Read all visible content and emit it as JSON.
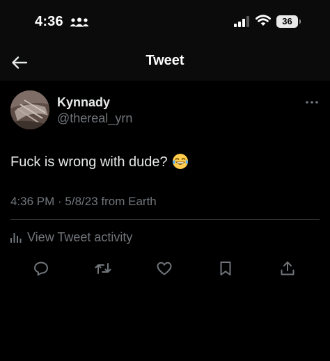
{
  "status_bar": {
    "time": "4:36",
    "battery": "36",
    "icons": [
      "people-icon",
      "signal-icon",
      "wifi-icon",
      "battery-icon"
    ]
  },
  "nav": {
    "title": "Tweet",
    "back_icon": "back-arrow-icon"
  },
  "tweet": {
    "author": {
      "display_name": "Kynnady",
      "handle": "@thereal_yrn"
    },
    "text": "Fuck is wrong with dude?",
    "emoji": "😂",
    "meta": "4:36 PM · 5/8/23 from Earth",
    "activity_label": "View Tweet activity"
  },
  "actions": [
    "reply-icon",
    "retweet-icon",
    "like-icon",
    "bookmark-icon",
    "share-icon"
  ],
  "colors": {
    "background": "#000000",
    "bar_background": "#0b0b0b",
    "text_primary": "#e7e9ea",
    "text_secondary": "#71767b",
    "divider": "#2f3336"
  }
}
